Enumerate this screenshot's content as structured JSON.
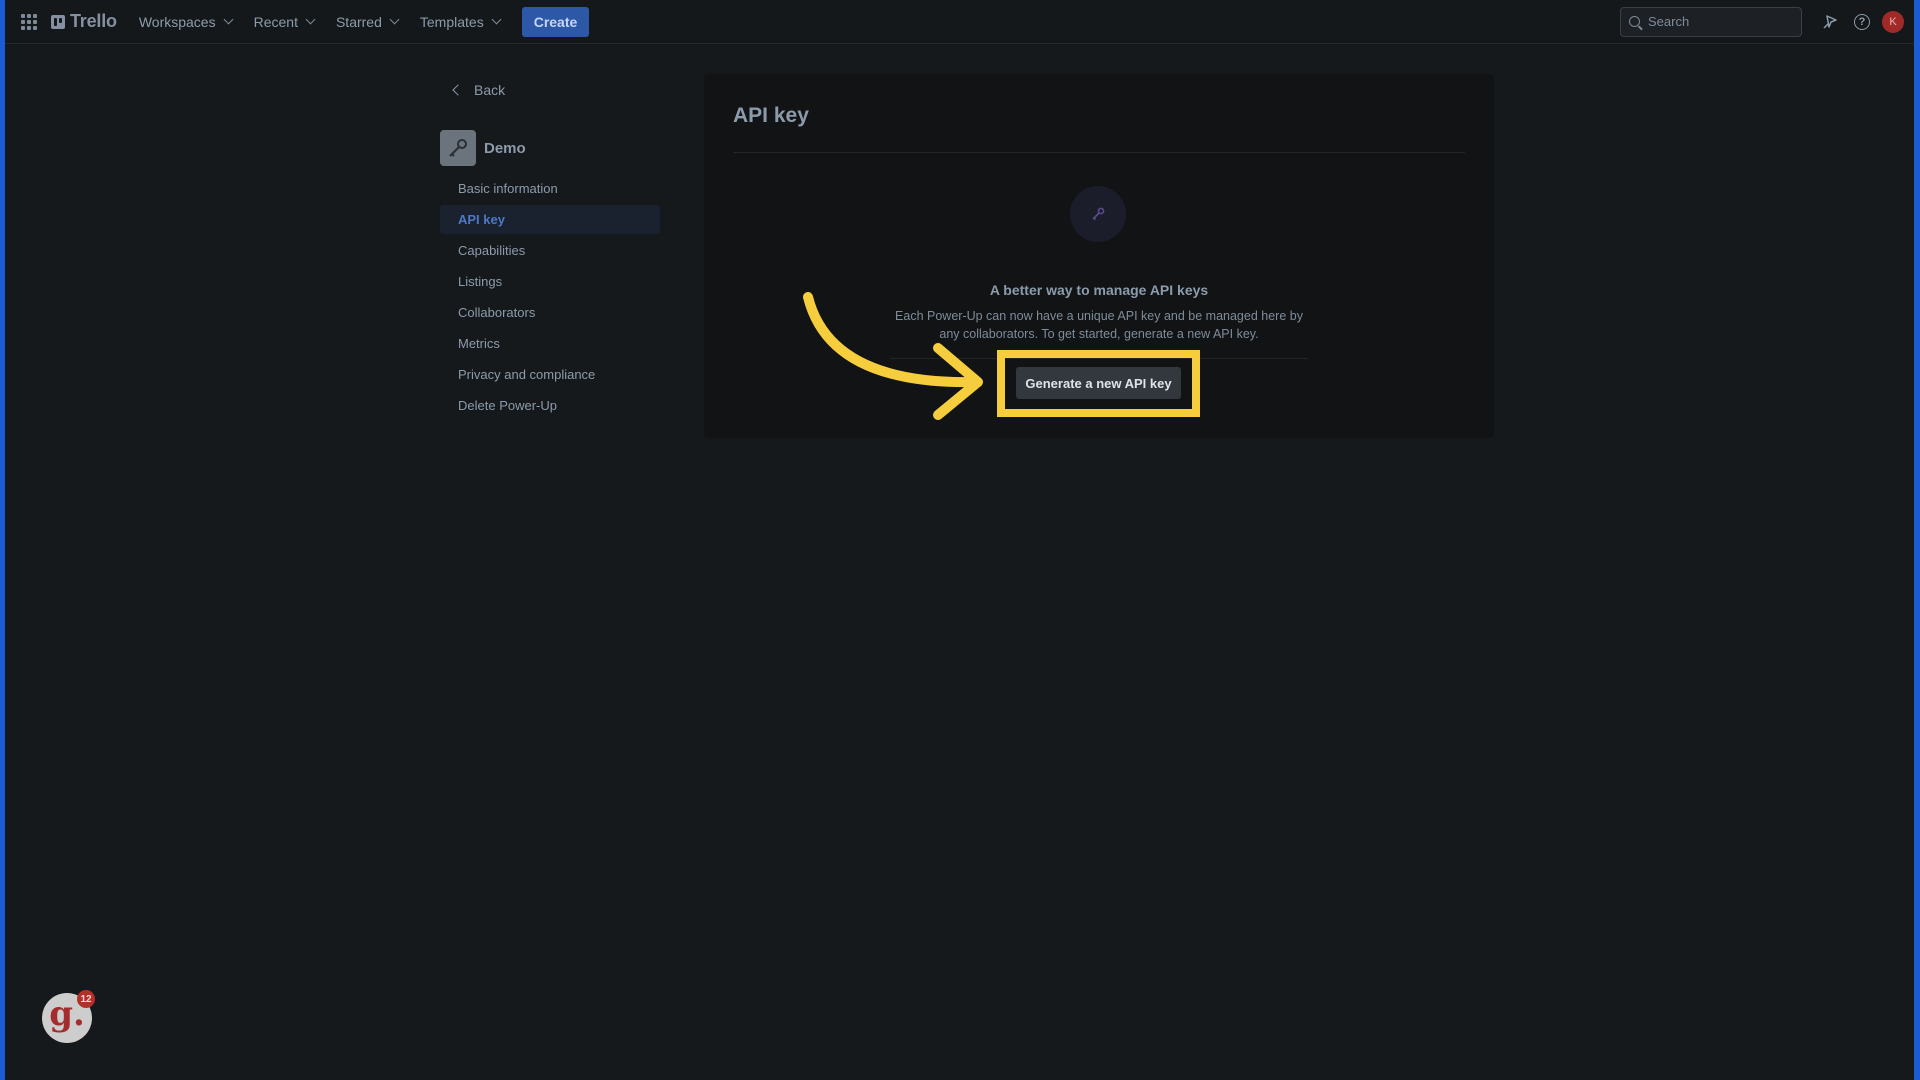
{
  "topbar": {
    "logo": "Trello",
    "nav": [
      "Workspaces",
      "Recent",
      "Starred",
      "Templates"
    ],
    "create_label": "Create",
    "search_placeholder": "Search",
    "avatar_initial": "K"
  },
  "sidebar": {
    "back_label": "Back",
    "powerup_name": "Demo",
    "items": [
      {
        "label": "Basic information",
        "active": false
      },
      {
        "label": "API key",
        "active": true
      },
      {
        "label": "Capabilities",
        "active": false
      },
      {
        "label": "Listings",
        "active": false
      },
      {
        "label": "Collaborators",
        "active": false
      },
      {
        "label": "Metrics",
        "active": false
      },
      {
        "label": "Privacy and compliance",
        "active": false
      },
      {
        "label": "Delete Power-Up",
        "active": false
      }
    ]
  },
  "main": {
    "title": "API key",
    "heading": "A better way to manage API keys",
    "description": "Each Power-Up can now have a unique API key and be managed here by any collaborators. To get started, generate a new API key.",
    "generate_label": "Generate a new API key"
  },
  "badge": {
    "letter": "g.",
    "count": "12"
  },
  "colors": {
    "highlight": "#f6cd3c",
    "accent": "#2d58a8",
    "active_text": "#4c78c4"
  },
  "icons": [
    "apps-grid-icon",
    "trello-logo-icon",
    "search-icon",
    "notification-icon",
    "help-icon",
    "key-icon",
    "back-chevron-icon",
    "arrow-annotation"
  ]
}
